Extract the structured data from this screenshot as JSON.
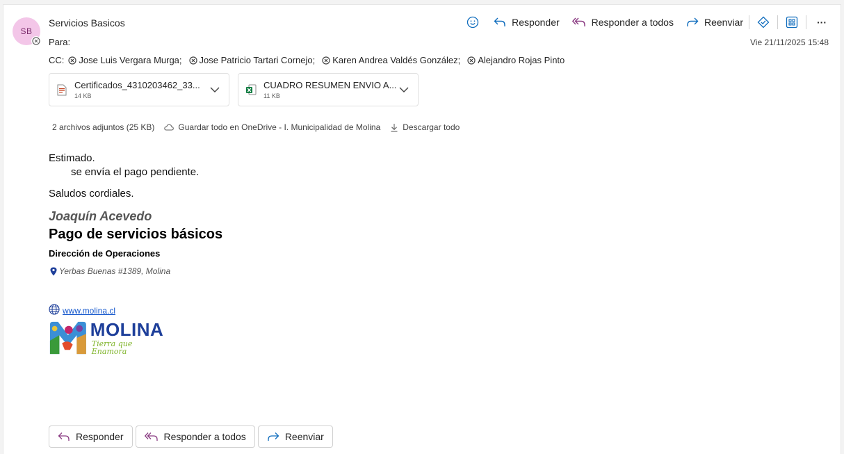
{
  "sender": {
    "initials": "SB",
    "name": "Servicios Basicos",
    "to_label": "Para:",
    "date": "Vie 21/11/2025 15:48"
  },
  "cc": {
    "label": "CC:",
    "recipients": [
      "Jose Luis Vergara Murga;",
      "Jose Patricio Tartari Cornejo;",
      "Karen Andrea Valdés González;",
      "Alejandro Rojas Pinto"
    ]
  },
  "toolbar": {
    "reply": "Responder",
    "reply_all": "Responder a todos",
    "forward": "Reenviar",
    "more": "···"
  },
  "attachments": [
    {
      "name": "Certificados_4310203462_33...",
      "size": "14 KB",
      "type": "pdf"
    },
    {
      "name": "CUADRO RESUMEN ENVIO A...",
      "size": "11 KB",
      "type": "excel"
    }
  ],
  "attachment_actions": {
    "summary": "2 archivos adjuntos (25 KB)",
    "save_onedrive": "Guardar todo en OneDrive - I. Municipalidad de Molina",
    "download_all": "Descargar todo"
  },
  "body": {
    "greeting": "Estimado.",
    "line1": "se envía el pago pendiente.",
    "closing": "Saludos cordiales."
  },
  "signature": {
    "name": "Joaquín Acevedo",
    "title": "Pago de servicios básicos",
    "department": "Dirección de Operaciones",
    "address": "Yerbas Buenas #1389, Molina",
    "website": "www.molina.cl",
    "logo_main": "MOLINA",
    "logo_sub": "Tierra que Enamora"
  },
  "bottom_actions": {
    "reply": "Responder",
    "reply_all": "Responder a todos",
    "forward": "Reenviar"
  },
  "colors": {
    "accent": "#0f6cbd",
    "reply_all_icon": "#8a3b82",
    "avatar_bg": "#f3c6e8"
  }
}
